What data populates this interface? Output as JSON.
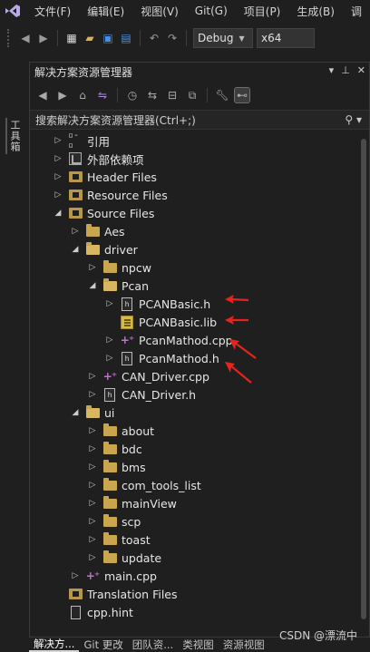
{
  "menu": [
    "文件(F)",
    "编辑(E)",
    "视图(V)",
    "Git(G)",
    "项目(P)",
    "生成(B)",
    "调"
  ],
  "toolbar": {
    "config": "Debug",
    "platform": "x64"
  },
  "toolbox_tab": "工具箱",
  "panel": {
    "title": "解决方案资源管理器",
    "search_placeholder": "搜索解决方案资源管理器(Ctrl+;)"
  },
  "tree": [
    {
      "label": "引用",
      "icon": "references-icon",
      "indent": 0,
      "expanded": false
    },
    {
      "label": "外部依赖项",
      "icon": "external-dependencies-icon",
      "indent": 0,
      "expanded": false
    },
    {
      "label": "Header Files",
      "icon": "filter-folder-icon",
      "indent": 0,
      "expanded": false
    },
    {
      "label": "Resource Files",
      "icon": "filter-folder-icon",
      "indent": 0,
      "expanded": false
    },
    {
      "label": "Source Files",
      "icon": "filter-folder-icon",
      "indent": 0,
      "expanded": true
    },
    {
      "label": "Aes",
      "icon": "folder-icon",
      "indent": 1,
      "expanded": false
    },
    {
      "label": "driver",
      "icon": "folder-icon",
      "indent": 1,
      "expanded": true
    },
    {
      "label": "npcw",
      "icon": "folder-icon",
      "indent": 2,
      "expanded": false
    },
    {
      "label": "Pcan",
      "icon": "folder-icon",
      "indent": 2,
      "expanded": true
    },
    {
      "label": "PCANBasic.h",
      "icon": "header-file-icon",
      "indent": 3,
      "expanded": false
    },
    {
      "label": "PCANBasic.lib",
      "icon": "library-file-icon",
      "indent": 3,
      "expanded": null
    },
    {
      "label": "PcanMathod.cpp",
      "icon": "cpp-file-icon",
      "indent": 3,
      "expanded": false
    },
    {
      "label": "PcanMathod.h",
      "icon": "header-file-icon",
      "indent": 3,
      "expanded": false
    },
    {
      "label": "CAN_Driver.cpp",
      "icon": "cpp-file-icon",
      "indent": 2,
      "expanded": false
    },
    {
      "label": "CAN_Driver.h",
      "icon": "header-file-icon",
      "indent": 2,
      "expanded": false
    },
    {
      "label": "ui",
      "icon": "folder-icon",
      "indent": 1,
      "expanded": true
    },
    {
      "label": "about",
      "icon": "folder-icon",
      "indent": 2,
      "expanded": false
    },
    {
      "label": "bdc",
      "icon": "folder-icon",
      "indent": 2,
      "expanded": false
    },
    {
      "label": "bms",
      "icon": "folder-icon",
      "indent": 2,
      "expanded": false
    },
    {
      "label": "com_tools_list",
      "icon": "folder-icon",
      "indent": 2,
      "expanded": false
    },
    {
      "label": "mainView",
      "icon": "folder-icon",
      "indent": 2,
      "expanded": false
    },
    {
      "label": "scp",
      "icon": "folder-icon",
      "indent": 2,
      "expanded": false
    },
    {
      "label": "toast",
      "icon": "folder-icon",
      "indent": 2,
      "expanded": false
    },
    {
      "label": "update",
      "icon": "folder-icon",
      "indent": 2,
      "expanded": false
    },
    {
      "label": "main.cpp",
      "icon": "cpp-file-icon",
      "indent": 1,
      "expanded": false
    },
    {
      "label": "Translation Files",
      "icon": "filter-folder-icon",
      "indent": 0,
      "expanded": null
    },
    {
      "label": "cpp.hint",
      "icon": "plain-file-icon",
      "indent": 0,
      "expanded": null
    }
  ],
  "bottom_tabs": [
    "解决方...",
    "Git 更改",
    "团队资...",
    "类视图",
    "资源视图"
  ],
  "watermark": "CSDN @漂流中",
  "colors": {
    "background": "#1f1f1f",
    "folder": "#c9a64e",
    "cpp_icon": "#c86cd8",
    "annotation_arrow": "#e8231d"
  }
}
